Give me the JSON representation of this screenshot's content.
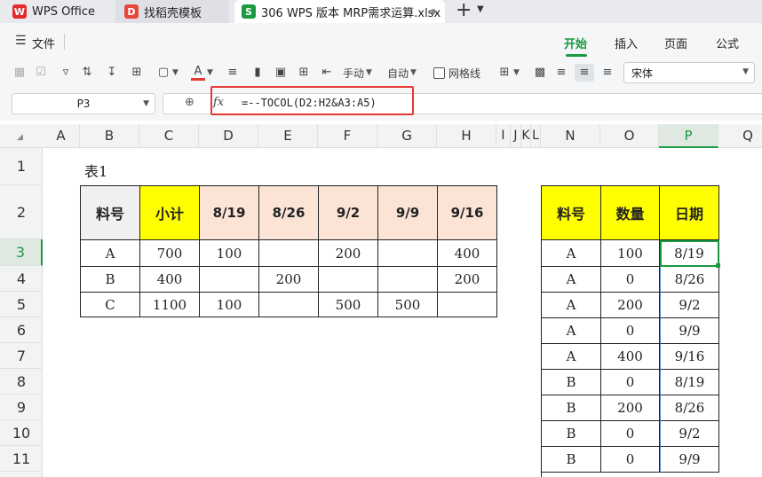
{
  "tabs": [
    {
      "label": "WPS Office"
    },
    {
      "label": "找稻壳模板"
    },
    {
      "label": "306 WPS 版本 MRP需求运算.xlsx"
    }
  ],
  "new_tab": "+",
  "menu": {
    "file": "文件",
    "items": [
      "开始",
      "插入",
      "页面",
      "公式"
    ],
    "active": "开始"
  },
  "toolbar": {
    "manual": "手动",
    "auto": "自动",
    "gridlines": "网格线",
    "font": "宋体"
  },
  "name_box": "P3",
  "formula": "=--TOCOL(D2:H2&A3:A5)",
  "columns": [
    "A",
    "B",
    "C",
    "D",
    "E",
    "F",
    "G",
    "H",
    "I",
    "J",
    "K",
    "L",
    "N",
    "O",
    "P",
    "Q"
  ],
  "rows": [
    "1",
    "2",
    "3",
    "4",
    "5",
    "6",
    "7",
    "8",
    "9",
    "10",
    "11"
  ],
  "table1": {
    "title": "表1",
    "headers": [
      "料号",
      "小计",
      "8/19",
      "8/26",
      "9/2",
      "9/9",
      "9/16"
    ],
    "rows": [
      [
        "A",
        "700",
        "100",
        "",
        "200",
        "",
        "400"
      ],
      [
        "B",
        "400",
        "",
        "200",
        "",
        "",
        "200"
      ],
      [
        "C",
        "1100",
        "100",
        "",
        "500",
        "500",
        ""
      ]
    ]
  },
  "table2": {
    "headers": [
      "料号",
      "数量",
      "日期"
    ],
    "rows": [
      [
        "A",
        "100",
        "8/19"
      ],
      [
        "A",
        "0",
        "8/26"
      ],
      [
        "A",
        "200",
        "9/2"
      ],
      [
        "A",
        "0",
        "9/9"
      ],
      [
        "A",
        "400",
        "9/16"
      ],
      [
        "B",
        "0",
        "8/19"
      ],
      [
        "B",
        "200",
        "8/26"
      ],
      [
        "B",
        "0",
        "9/2"
      ],
      [
        "B",
        "0",
        "9/9"
      ]
    ]
  },
  "colors": {
    "accent": "#1a9a42",
    "header_yellow": "#ffff00",
    "header_peach": "#fbe3d6",
    "highlight_red": "#e53935"
  }
}
